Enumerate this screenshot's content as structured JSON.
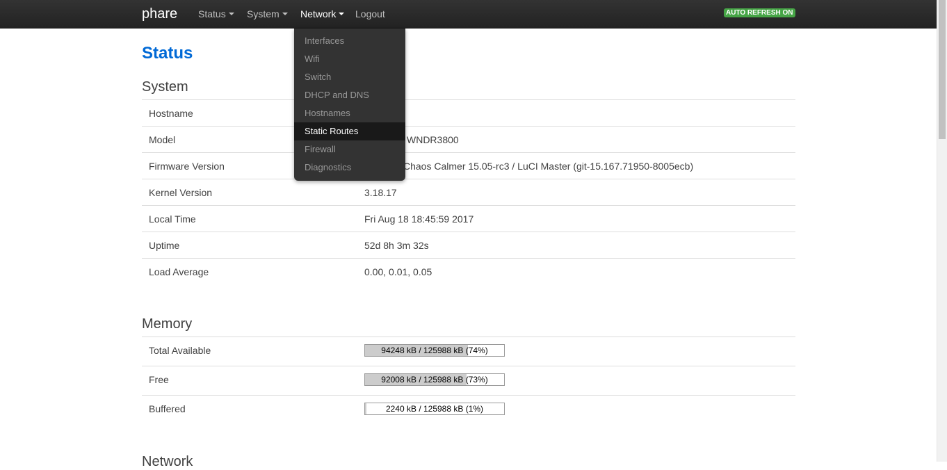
{
  "navbar": {
    "brand": "phare",
    "items": [
      {
        "label": "Status",
        "has_caret": true
      },
      {
        "label": "System",
        "has_caret": true
      },
      {
        "label": "Network",
        "has_caret": true
      },
      {
        "label": "Logout",
        "has_caret": false
      }
    ],
    "auto_refresh_label": "AUTO REFRESH ON"
  },
  "network_menu": {
    "items": [
      {
        "label": "Interfaces"
      },
      {
        "label": "Wifi"
      },
      {
        "label": "Switch"
      },
      {
        "label": "DHCP and DNS"
      },
      {
        "label": "Hostnames"
      },
      {
        "label": "Static Routes",
        "selected": true
      },
      {
        "label": "Firewall"
      },
      {
        "label": "Diagnostics"
      }
    ]
  },
  "page": {
    "title": "Status"
  },
  "system": {
    "heading": "System",
    "rows": [
      {
        "label": "Hostname",
        "value": ""
      },
      {
        "label": "Model",
        "value": "R WNDR3800"
      },
      {
        "label": "Firmware Version",
        "value": "Chaos Calmer 15.05-rc3 / LuCI Master (git-15.167.71950-8005ecb)"
      },
      {
        "label": "Kernel Version",
        "value": "3.18.17"
      },
      {
        "label": "Local Time",
        "value": "Fri Aug 18 18:45:59 2017"
      },
      {
        "label": "Uptime",
        "value": "52d 8h 3m 32s"
      },
      {
        "label": "Load Average",
        "value": "0.00, 0.01, 0.05"
      }
    ]
  },
  "memory": {
    "heading": "Memory",
    "rows": [
      {
        "label": "Total Available",
        "bar_text": "94248 kB / 125988 kB (74%)",
        "percent": 74
      },
      {
        "label": "Free",
        "bar_text": "92008 kB / 125988 kB (73%)",
        "percent": 73
      },
      {
        "label": "Buffered",
        "bar_text": "2240 kB / 125988 kB (1%)",
        "percent": 1
      }
    ]
  },
  "next_section": {
    "heading": "Network"
  },
  "colors": {
    "accent": "#0069d6",
    "badge": "#46a546",
    "navbar": "#222222"
  }
}
